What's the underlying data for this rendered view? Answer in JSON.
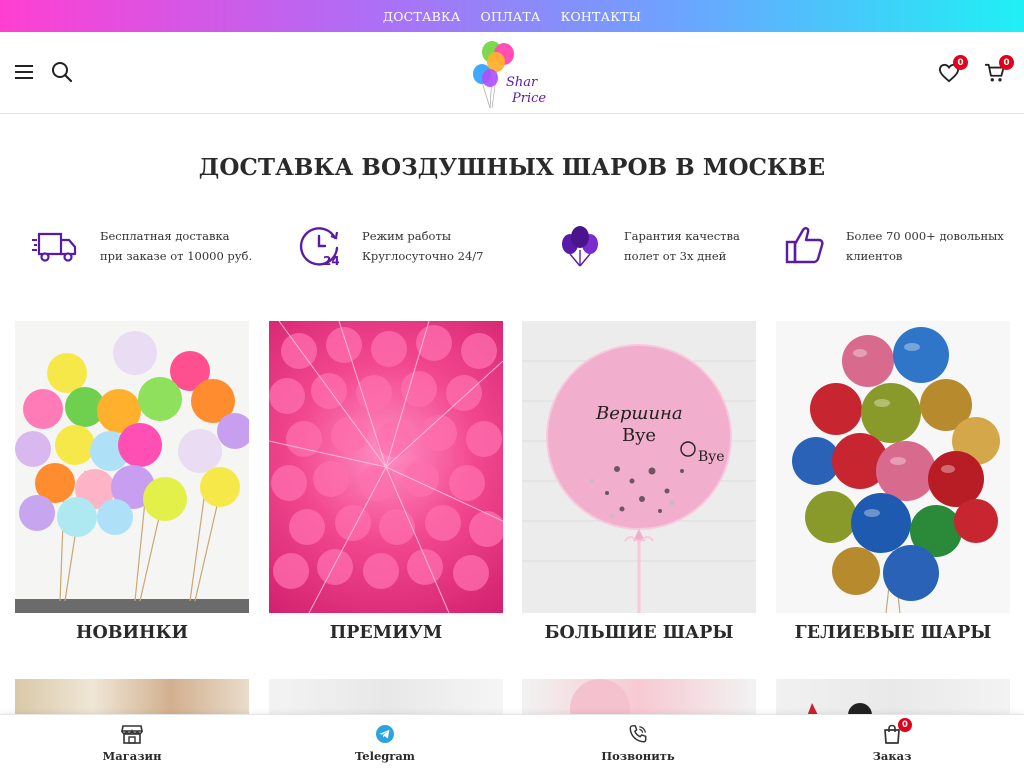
{
  "topbar": {
    "links": [
      "ДОСТАВКА",
      "ОПЛАТА",
      "КОНТАКТЫ"
    ]
  },
  "header": {
    "logo_text_top": "Shar",
    "logo_text_bottom": "Price",
    "wishlist_count": "0",
    "cart_count": "0"
  },
  "main_title": "ДОСТАВКА ВОЗДУШНЫХ ШАРОВ В МОСКВЕ",
  "features": [
    {
      "icon": "delivery-truck-icon",
      "line1": "Бесплатная доставка",
      "line2": "при заказе от 10000 руб."
    },
    {
      "icon": "clock-24-icon",
      "line1": "Режим работы",
      "line2": "Круглосуточно 24/7"
    },
    {
      "icon": "balloons-icon",
      "line1": "Гарантия качества",
      "line2": "полет от 3х дней"
    },
    {
      "icon": "thumbs-up-icon",
      "line1": "Более 70 000+ довольных",
      "line2": "клиентов"
    }
  ],
  "categories": [
    {
      "label": "НОВИНКИ"
    },
    {
      "label": "ПРЕМИУМ"
    },
    {
      "label": "БОЛЬШИЕ ШАРЫ",
      "image_text_1": "Вершина",
      "image_text_2": "Bye",
      "image_text_3": "Bye"
    },
    {
      "label": "ГЕЛИЕВЫЕ ШАРЫ"
    }
  ],
  "bottom_nav": [
    {
      "label": "Магазин",
      "icon": "store-icon"
    },
    {
      "label": "Telegram",
      "icon": "telegram-icon"
    },
    {
      "label": "Позвонить",
      "icon": "phone-icon"
    },
    {
      "label": "Заказ",
      "icon": "shopping-bag-icon",
      "count": "0"
    }
  ],
  "colors": {
    "accent_purple": "#5a1aa8",
    "badge_red": "#e0001b",
    "topbar_gradient_start": "#ff3fd2",
    "topbar_gradient_end": "#1ff0f5"
  }
}
